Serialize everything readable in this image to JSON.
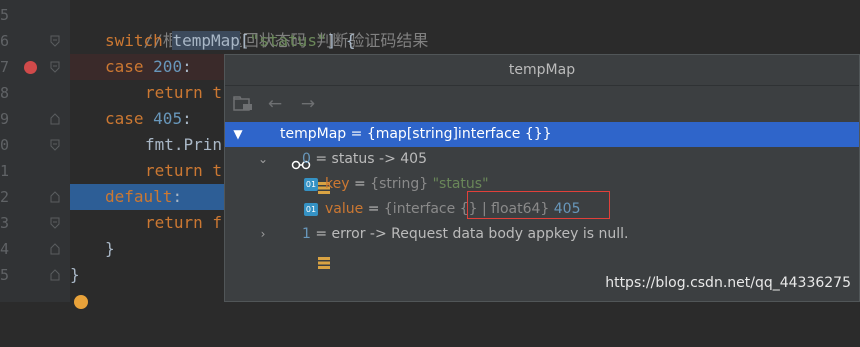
{
  "gutter": {
    "line_numbers": [
      "5",
      "6",
      "7",
      "8",
      "9",
      "0",
      "1",
      "2",
      "3",
      "4",
      "5"
    ]
  },
  "editor": {
    "comment": "//根据接口返回状态码 判断验证码结果",
    "switch_kw": "switch",
    "switch_var": "tempMap",
    "switch_key": "\"status\"",
    "switch_brace": "] {",
    "case1_kw": "case",
    "case1_val": "200",
    "case1_colon": ":",
    "return1": "return t",
    "case2_kw": "case",
    "case2_val": "405",
    "case2_colon": ":",
    "fmt_line": "fmt.Prin",
    "return2": "return t",
    "default_kw": "default",
    "default_colon": ":",
    "return3": "return f",
    "close_brace1": "}",
    "close_brace2": "}"
  },
  "popup": {
    "title": "tempMap",
    "toolbar_icons": [
      "folder-icon",
      "back-arrow-icon",
      "forward-arrow-icon"
    ],
    "root": {
      "name": "tempMap",
      "eq": " = ",
      "value": "{map[string]interface {}}"
    },
    "entry0": {
      "index": "0",
      "text": " = status -> 405"
    },
    "key_field": {
      "icon": "01",
      "name": "key",
      "eq": " = ",
      "type": "{string}",
      "value": " \"status\""
    },
    "value_field": {
      "icon": "01",
      "name": "value",
      "eq": " = ",
      "type": "{interface {}",
      "type2": " | float64}",
      "value": " 405"
    },
    "entry1": {
      "index": "1",
      "text": " = error -> Request data body appkey is null."
    }
  },
  "watermark": "https://blog.csdn.net/qq_44336275"
}
